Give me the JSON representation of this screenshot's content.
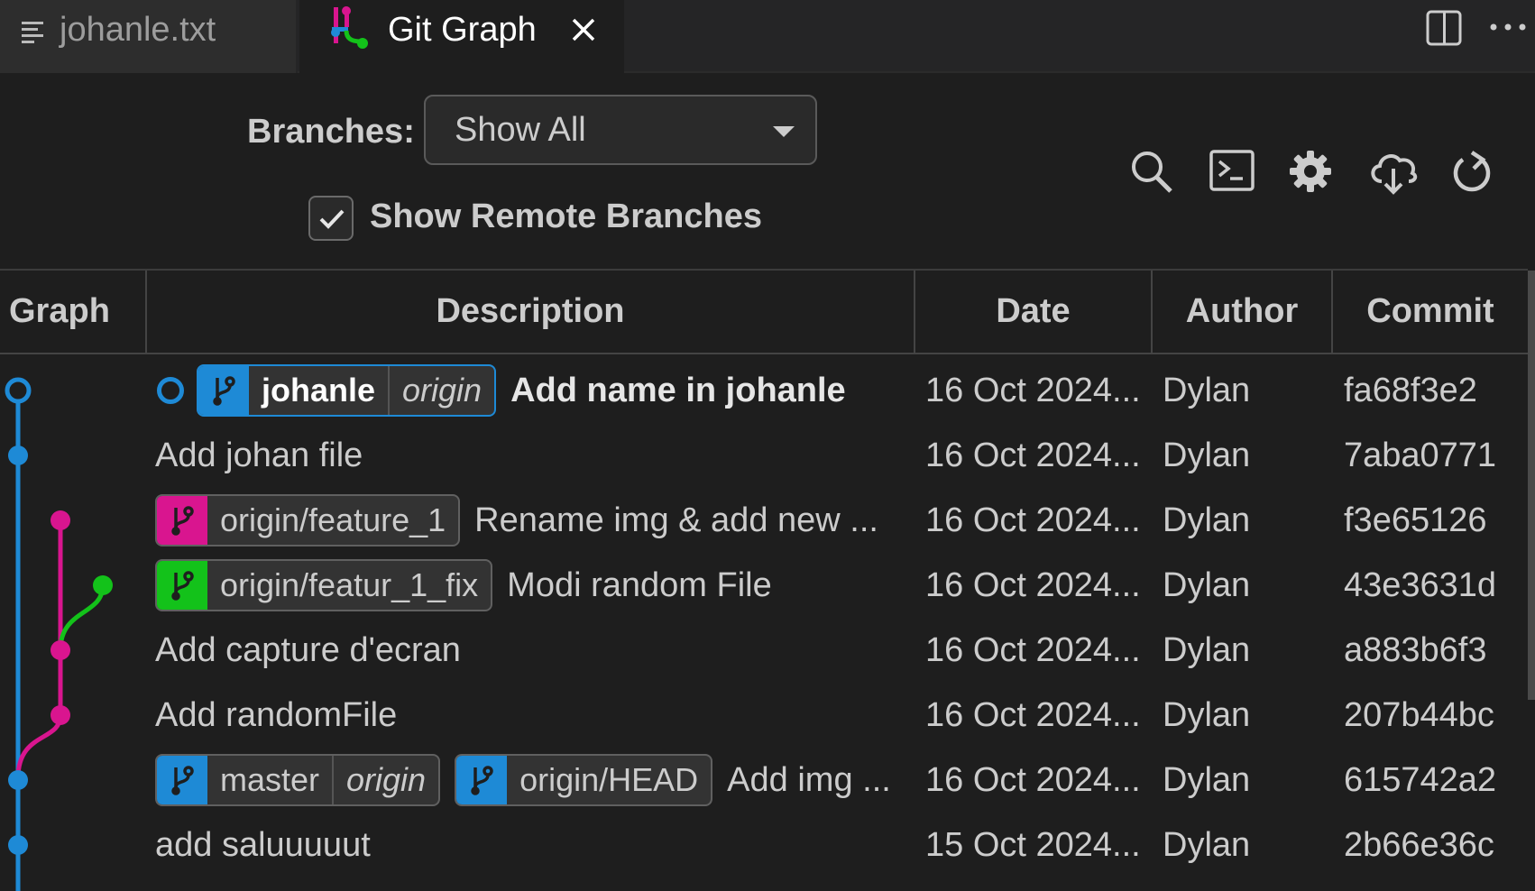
{
  "tabs": [
    {
      "label": "johanle.txt",
      "icon": "lines-icon",
      "active": false
    },
    {
      "label": "Git Graph",
      "icon": "git-graph-icon",
      "active": true
    }
  ],
  "controls": {
    "branches_label": "Branches:",
    "branches_value": "Show All",
    "show_remote_label": "Show Remote Branches",
    "show_remote_checked": true
  },
  "toolbar_icons": [
    "search-icon",
    "terminal-icon",
    "gear-icon",
    "cloud-download-icon",
    "refresh-icon"
  ],
  "table": {
    "headers": {
      "graph": "Graph",
      "description": "Description",
      "date": "Date",
      "author": "Author",
      "commit": "Commit"
    },
    "rows": [
      {
        "description": "Add name in johanle",
        "date": "16 Oct 2024...",
        "author": "Dylan",
        "commit": "fa68f3e2",
        "refs": [
          {
            "name": "johanle",
            "remote": "origin",
            "color": "#1e8ad6"
          }
        ]
      },
      {
        "description": "Add johan file",
        "date": "16 Oct 2024...",
        "author": "Dylan",
        "commit": "7aba0771",
        "refs": []
      },
      {
        "description": "Rename img & add new ...",
        "date": "16 Oct 2024...",
        "author": "Dylan",
        "commit": "f3e65126",
        "refs": [
          {
            "name": "origin/feature_1",
            "color": "#d9158f"
          }
        ]
      },
      {
        "description": "Modi random File",
        "date": "16 Oct 2024...",
        "author": "Dylan",
        "commit": "43e3631d",
        "refs": [
          {
            "name": "origin/featur_1_fix",
            "color": "#13c21a"
          }
        ]
      },
      {
        "description": "Add capture d'ecran",
        "date": "16 Oct 2024...",
        "author": "Dylan",
        "commit": "a883b6f3",
        "refs": []
      },
      {
        "description": "Add randomFile",
        "date": "16 Oct 2024...",
        "author": "Dylan",
        "commit": "207b44bc",
        "refs": []
      },
      {
        "description": "Add img ...",
        "date": "16 Oct 2024...",
        "author": "Dylan",
        "commit": "615742a2",
        "refs": [
          {
            "name": "master",
            "remote": "origin",
            "color": "#1e8ad6"
          },
          {
            "name": "origin/HEAD",
            "color": "#1e8ad6"
          }
        ]
      },
      {
        "description": "add saluuuuut",
        "date": "15 Oct 2024...",
        "author": "Dylan",
        "commit": "2b66e36c",
        "refs": []
      }
    ]
  },
  "colors": {
    "blue": "#1e8ad6",
    "pink": "#d9158f",
    "green": "#13c21a"
  }
}
